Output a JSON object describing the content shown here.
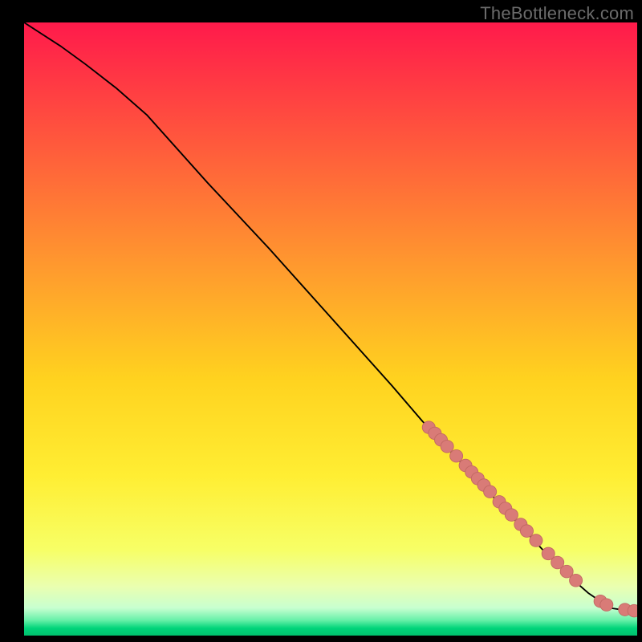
{
  "watermark": "TheBottleneck.com",
  "colors": {
    "bg": "#000000",
    "watermark": "#6b6b6b",
    "line": "#000000",
    "marker_fill": "#d97b77",
    "marker_stroke": "#c26863",
    "gradient_stops": [
      {
        "offset": 0.0,
        "color": "#ff1a4b"
      },
      {
        "offset": 0.2,
        "color": "#ff5a3c"
      },
      {
        "offset": 0.4,
        "color": "#ff9a2e"
      },
      {
        "offset": 0.58,
        "color": "#ffd21f"
      },
      {
        "offset": 0.74,
        "color": "#ffee33"
      },
      {
        "offset": 0.86,
        "color": "#f7ff66"
      },
      {
        "offset": 0.92,
        "color": "#eaffb0"
      },
      {
        "offset": 0.955,
        "color": "#c8ffd0"
      },
      {
        "offset": 0.975,
        "color": "#66f0a8"
      },
      {
        "offset": 0.988,
        "color": "#00d47a"
      },
      {
        "offset": 1.0,
        "color": "#00c06e"
      }
    ]
  },
  "chart_data": {
    "type": "line",
    "title": "",
    "xlabel": "",
    "ylabel": "",
    "xlim": [
      0,
      100
    ],
    "ylim": [
      0,
      100
    ],
    "series": [
      {
        "name": "curve",
        "x": [
          0,
          3,
          6,
          10,
          15,
          20,
          30,
          40,
          50,
          60,
          65,
          70,
          75,
          80,
          85,
          88,
          90,
          92,
          94,
          95,
          96,
          98,
          100
        ],
        "y": [
          100,
          98,
          96,
          93,
          89,
          84.5,
          73,
          62,
          50.5,
          39,
          33,
          27.5,
          22,
          16.5,
          11,
          8,
          6,
          4.2,
          2.8,
          2.0,
          1.6,
          1.3,
          1.2
        ]
      }
    ],
    "markers": {
      "comment": "Highlighted data points (salmon dots) clustered on lower-right of curve",
      "points": [
        {
          "x": 66,
          "y": 32.0
        },
        {
          "x": 67,
          "y": 31.0
        },
        {
          "x": 68,
          "y": 29.9
        },
        {
          "x": 69,
          "y": 28.8
        },
        {
          "x": 70.5,
          "y": 27.2
        },
        {
          "x": 72,
          "y": 25.6
        },
        {
          "x": 73,
          "y": 24.5
        },
        {
          "x": 74,
          "y": 23.4
        },
        {
          "x": 75,
          "y": 22.3
        },
        {
          "x": 76,
          "y": 21.2
        },
        {
          "x": 77.5,
          "y": 19.5
        },
        {
          "x": 78.5,
          "y": 18.4
        },
        {
          "x": 79.5,
          "y": 17.3
        },
        {
          "x": 81,
          "y": 15.7
        },
        {
          "x": 82,
          "y": 14.6
        },
        {
          "x": 83.5,
          "y": 13.0
        },
        {
          "x": 85.5,
          "y": 10.8
        },
        {
          "x": 87,
          "y": 9.3
        },
        {
          "x": 88.5,
          "y": 7.8
        },
        {
          "x": 90,
          "y": 6.3
        },
        {
          "x": 94,
          "y": 2.8
        },
        {
          "x": 95,
          "y": 2.2
        },
        {
          "x": 98,
          "y": 1.4
        },
        {
          "x": 99.5,
          "y": 1.2
        }
      ]
    }
  }
}
